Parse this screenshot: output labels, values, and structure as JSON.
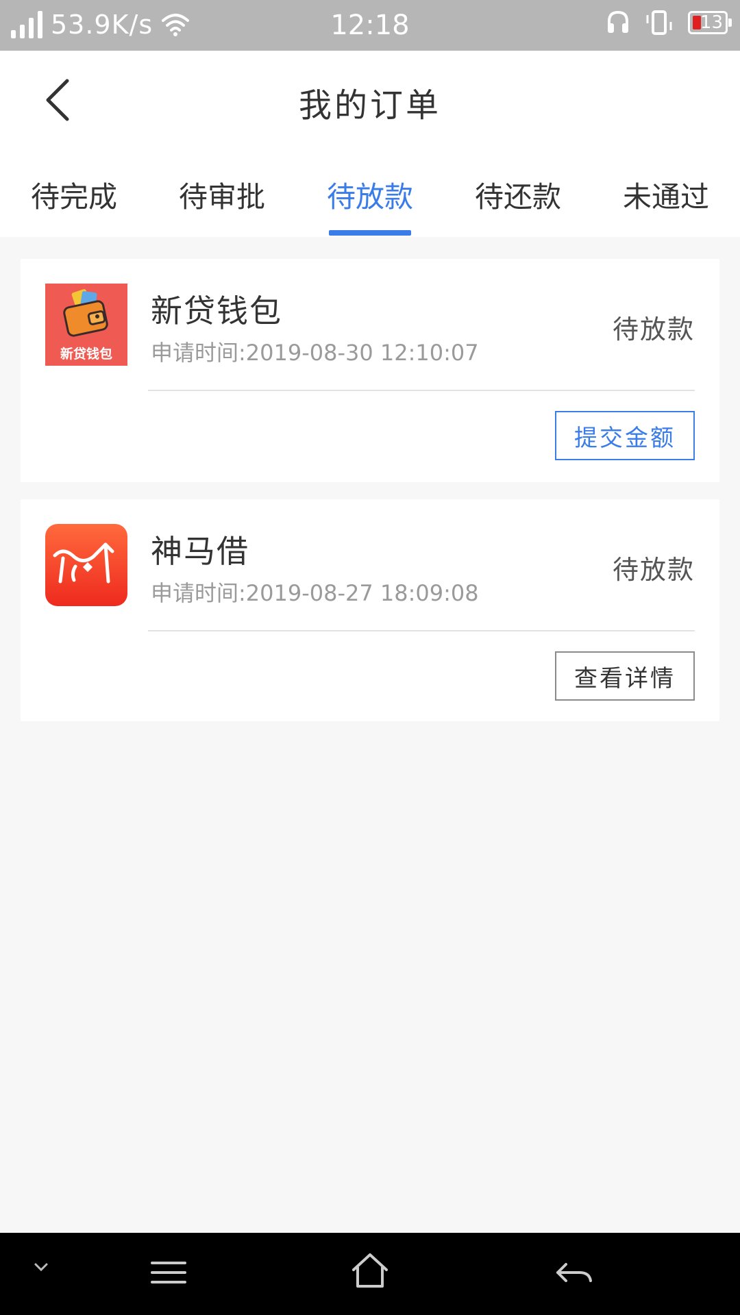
{
  "status_bar": {
    "speed": "53.9K/s",
    "time": "12:18",
    "battery": "13"
  },
  "header": {
    "title": "我的订单"
  },
  "tabs": [
    {
      "label": "待完成",
      "active": false
    },
    {
      "label": "待审批",
      "active": false
    },
    {
      "label": "待放款",
      "active": true
    },
    {
      "label": "待还款",
      "active": false
    },
    {
      "label": "未通过",
      "active": false
    }
  ],
  "orders": [
    {
      "name": "新贷钱包",
      "logo_text": "新贷钱包",
      "time": "申请时间:2019-08-30 12:10:07",
      "status": "待放款",
      "action": "提交金额",
      "action_style": "primary"
    },
    {
      "name": "神马借",
      "time": "申请时间:2019-08-27 18:09:08",
      "status": "待放款",
      "action": "查看详情",
      "action_style": "secondary"
    }
  ],
  "colors": {
    "accent": "#3a7ce8",
    "status_bar": "#b6b6b6",
    "page_bg": "#f7f7f7"
  },
  "icons": {
    "back": "chevron-left-icon",
    "nav_down": "chevron-down-icon",
    "nav_menu": "menu-icon",
    "nav_home": "home-icon",
    "nav_back": "return-arrow-icon"
  }
}
